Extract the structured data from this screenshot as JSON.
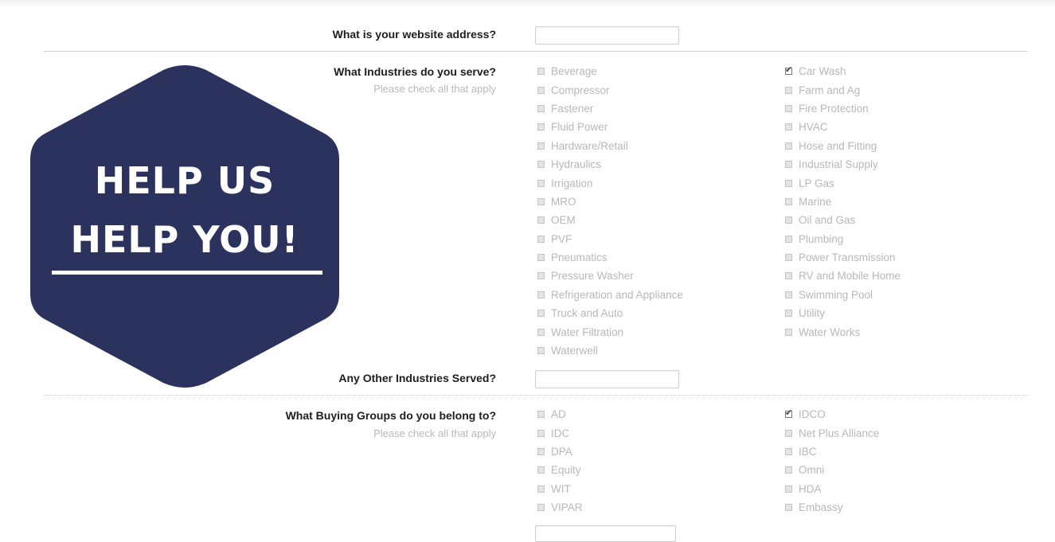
{
  "website": {
    "label": "What is your website address?",
    "value": ""
  },
  "industries": {
    "label": "What Industries do you serve?",
    "sublabel": "Please check all that apply",
    "col1": [
      {
        "label": "Beverage",
        "checked": false
      },
      {
        "label": "Compressor",
        "checked": false
      },
      {
        "label": "Fastener",
        "checked": false
      },
      {
        "label": "Fluid Power",
        "checked": false
      },
      {
        "label": "Hardware/Retail",
        "checked": false
      },
      {
        "label": "Hydraulics",
        "checked": false
      },
      {
        "label": "Irrigation",
        "checked": false
      },
      {
        "label": "MRO",
        "checked": false
      },
      {
        "label": "OEM",
        "checked": false
      },
      {
        "label": "PVF",
        "checked": false
      },
      {
        "label": "Pneumatics",
        "checked": false
      },
      {
        "label": "Pressure Washer",
        "checked": false
      },
      {
        "label": "Refrigeration and Appliance",
        "checked": false
      },
      {
        "label": "Truck and Auto",
        "checked": false
      },
      {
        "label": "Water Filtration",
        "checked": false
      },
      {
        "label": "Waterwell",
        "checked": false
      }
    ],
    "col2": [
      {
        "label": "Car Wash",
        "checked": true
      },
      {
        "label": "Farm and Ag",
        "checked": false
      },
      {
        "label": "Fire Protection",
        "checked": false
      },
      {
        "label": "HVAC",
        "checked": false
      },
      {
        "label": "Hose and Fitting",
        "checked": false
      },
      {
        "label": "Industrial Supply",
        "checked": false
      },
      {
        "label": "LP Gas",
        "checked": false
      },
      {
        "label": "Marine",
        "checked": false
      },
      {
        "label": "Oil and Gas",
        "checked": false
      },
      {
        "label": "Plumbing",
        "checked": false
      },
      {
        "label": "Power Transmission",
        "checked": false
      },
      {
        "label": "RV and Mobile Home",
        "checked": false
      },
      {
        "label": "Swimming Pool",
        "checked": false
      },
      {
        "label": "Utility",
        "checked": false
      },
      {
        "label": "Water Works",
        "checked": false
      }
    ]
  },
  "other_industries": {
    "label": "Any Other Industries Served?",
    "value": ""
  },
  "buying_groups": {
    "label": "What Buying Groups do you belong to?",
    "sublabel": "Please check all that apply",
    "col1": [
      {
        "label": "AD",
        "checked": false
      },
      {
        "label": "IDC",
        "checked": false
      },
      {
        "label": "DPA",
        "checked": false
      },
      {
        "label": "Equity",
        "checked": false
      },
      {
        "label": "WIT",
        "checked": false
      },
      {
        "label": "VIPAR",
        "checked": false
      }
    ],
    "col2": [
      {
        "label": "IDCO",
        "checked": true
      },
      {
        "label": "Net Plus Alliance",
        "checked": false
      },
      {
        "label": "IBC",
        "checked": false
      },
      {
        "label": "Omni",
        "checked": false
      },
      {
        "label": "HDA",
        "checked": false
      },
      {
        "label": "Embassy",
        "checked": false
      }
    ]
  },
  "badge": {
    "line1": "HELP US",
    "line2": "HELP YOU!",
    "color": "#2b325e"
  }
}
